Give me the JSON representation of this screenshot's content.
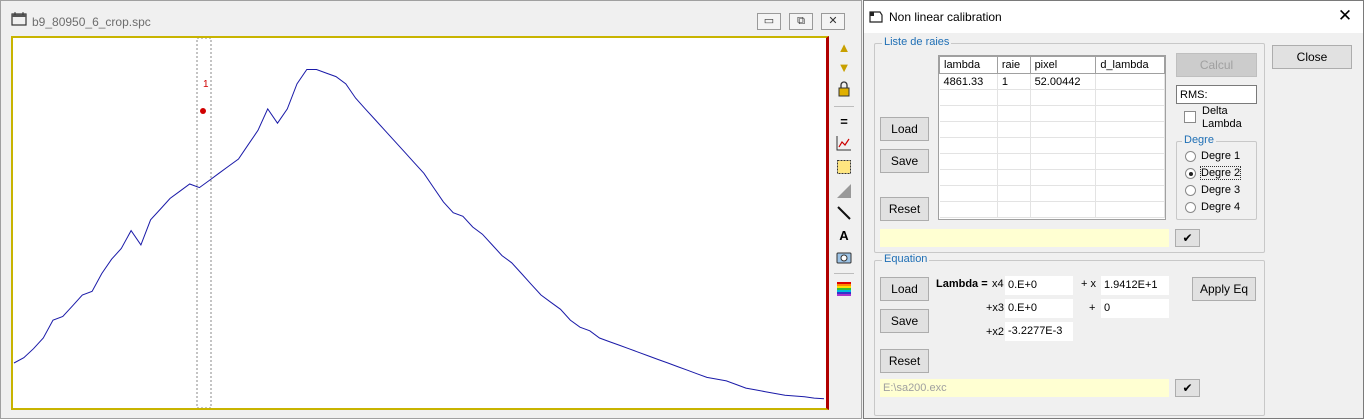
{
  "spectrum_window": {
    "title": "b9_80950_6_crop.spc",
    "controls": {
      "minimize": "▭",
      "restore": "⧉",
      "close": "✕"
    },
    "marker_label": "1",
    "line_color": "#1a1aa8",
    "marker_color": "#d00000",
    "chart_data": {
      "type": "line",
      "title": "",
      "xlabel": "",
      "ylabel": "",
      "grid": false,
      "series": [
        {
          "values": [
            0.12,
            0.135,
            0.16,
            0.19,
            0.24,
            0.25,
            0.28,
            0.31,
            0.32,
            0.37,
            0.41,
            0.44,
            0.49,
            0.45,
            0.52,
            0.55,
            0.58,
            0.6,
            0.62,
            0.61,
            0.63,
            0.65,
            0.67,
            0.69,
            0.73,
            0.77,
            0.83,
            0.79,
            0.83,
            0.9,
            0.94,
            0.94,
            0.93,
            0.92,
            0.9,
            0.86,
            0.83,
            0.8,
            0.77,
            0.74,
            0.71,
            0.68,
            0.65,
            0.61,
            0.57,
            0.54,
            0.53,
            0.5,
            0.48,
            0.45,
            0.42,
            0.4,
            0.37,
            0.34,
            0.31,
            0.29,
            0.27,
            0.24,
            0.22,
            0.21,
            0.19,
            0.18,
            0.17,
            0.16,
            0.15,
            0.14,
            0.13,
            0.12,
            0.11,
            0.1,
            0.09,
            0.08,
            0.075,
            0.07,
            0.06,
            0.05,
            0.045,
            0.04,
            0.035,
            0.03,
            0.028,
            0.026,
            0.022,
            0.02
          ]
        }
      ]
    }
  },
  "dialog": {
    "title": "Non linear calibration",
    "close_glyph": "✕",
    "liste": {
      "label": "Liste de raies",
      "columns": [
        "lambda",
        "raie",
        "pixel",
        "d_lambda"
      ],
      "rows": [
        [
          "4861.33",
          "1",
          "52.00442",
          ""
        ],
        [
          "",
          "",
          "",
          ""
        ],
        [
          "",
          "",
          "",
          ""
        ],
        [
          "",
          "",
          "",
          ""
        ],
        [
          "",
          "",
          "",
          ""
        ],
        [
          "",
          "",
          "",
          ""
        ],
        [
          "",
          "",
          "",
          ""
        ],
        [
          "",
          "",
          "",
          ""
        ],
        [
          "",
          "",
          "",
          ""
        ]
      ],
      "load": "Load",
      "save": "Save",
      "reset": "Reset",
      "calcul": "Calcul",
      "rms": "RMS:",
      "delta_lambda": "Delta Lambda",
      "degre_label": "Degre",
      "degrees": [
        "Degre 1",
        "Degre 2",
        "Degre 3",
        "Degre 4"
      ],
      "selected_degree": "Degre 2",
      "check_glyph": "✔"
    },
    "equation": {
      "label": "Equation",
      "load": "Load",
      "save": "Save",
      "reset": "Reset",
      "lambda_label": "Lambda =",
      "x4_label": "x4",
      "x4_value": "0.E+0",
      "x3_label": "+x3",
      "x3_value": "0.E+0",
      "x2_label": "+x2",
      "x2_value": "-3.2277E-3",
      "x_label": "+ x",
      "x_value": "1.9412E+1",
      "const_label": "+",
      "const_value": "0",
      "apply": "Apply Eq",
      "file_path": "E:\\sa200.exc",
      "check_glyph": "✔"
    },
    "close_button": "Close"
  }
}
